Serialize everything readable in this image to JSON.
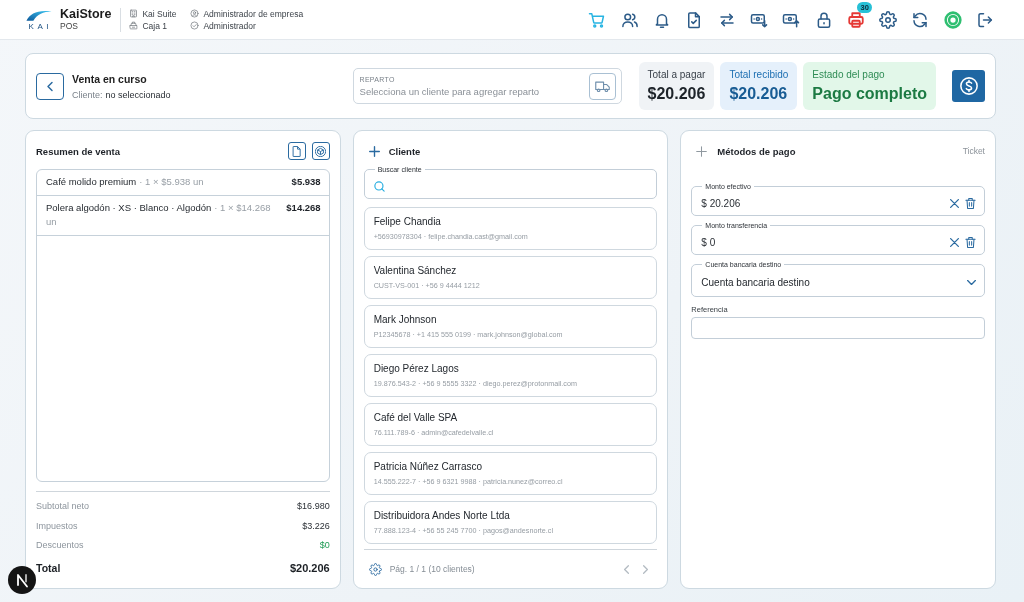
{
  "header": {
    "brand": {
      "logo_text": "KAI",
      "name": "KaiStore",
      "subtitle": "POS"
    },
    "context": [
      {
        "kind": "company",
        "label": "Kai Suite"
      },
      {
        "kind": "register",
        "label": "Caja 1"
      }
    ],
    "user": [
      {
        "kind": "role",
        "label": "Administrador de empresa"
      },
      {
        "kind": "profile",
        "label": "Administrador"
      }
    ],
    "toolbar": [
      {
        "kind": "cart",
        "selected": true
      },
      {
        "kind": "customers",
        "selected": false
      },
      {
        "kind": "notifications",
        "selected": false
      },
      {
        "kind": "documents",
        "selected": false
      },
      {
        "kind": "transfers",
        "selected": false
      },
      {
        "kind": "cash_in",
        "selected": false
      },
      {
        "kind": "cash_out",
        "selected": false
      },
      {
        "kind": "lock",
        "selected": false
      },
      {
        "kind": "printer",
        "selected": false,
        "color": "#e53935",
        "badge": "30"
      },
      {
        "kind": "settings",
        "selected": false
      },
      {
        "kind": "sync",
        "selected": false
      },
      {
        "kind": "status",
        "selected": false,
        "color": "#2fbf71"
      },
      {
        "kind": "logout",
        "selected": false
      }
    ]
  },
  "sale_bar": {
    "title": "Venta en curso",
    "client_label": "Cliente:",
    "client_value": "no seleccionado",
    "delivery": {
      "label": "REPARTO",
      "placeholder": "Selecciona un cliente para agregar reparto"
    },
    "totals": [
      {
        "kind": "due",
        "label": "Total a pagar",
        "value": "$20.206"
      },
      {
        "kind": "received",
        "label": "Total recibido",
        "value": "$20.206"
      },
      {
        "kind": "status",
        "label": "Estado del pago",
        "value": "Pago completo"
      }
    ]
  },
  "summary": {
    "title": "Resumen de venta",
    "items": [
      {
        "name": "Café molido premium",
        "detail": "· 1 × $5.938 un",
        "amount": "$5.938"
      },
      {
        "name": "Polera algodón · XS · Blanco · Algodón",
        "detail": "· 1 × $14.268 un",
        "amount": "$14.268"
      }
    ],
    "totals": [
      {
        "kind": "line",
        "label": "Subtotal neto",
        "value": "$16.980"
      },
      {
        "kind": "line",
        "label": "Impuestos",
        "value": "$3.226"
      },
      {
        "kind": "discount",
        "label": "Descuentos",
        "value": "$0"
      },
      {
        "kind": "total",
        "label": "Total",
        "value": "$20.206"
      }
    ]
  },
  "clients": {
    "title": "Cliente",
    "search": {
      "label": "Buscar cliente"
    },
    "list": [
      {
        "name": "Felipe Chandia",
        "detail": "+56930978304 · felipe.chandia.cast@gmail.com"
      },
      {
        "name": "Valentina Sánchez",
        "detail": "CUST-VS-001 · +56 9 4444 1212"
      },
      {
        "name": "Mark Johnson",
        "detail": "P12345678 · +1 415 555 0199 · mark.johnson@global.com"
      },
      {
        "name": "Diego Pérez Lagos",
        "detail": "19.876.543-2 · +56 9 5555 3322 · diego.perez@protonmail.com"
      },
      {
        "name": "Café del Valle SPA",
        "detail": "76.111.789-6 · admin@cafedelvalle.cl"
      },
      {
        "name": "Patricia Núñez Carrasco",
        "detail": "14.555.222-7 · +56 9 6321 9988 · patricia.nunez@correo.cl"
      },
      {
        "name": "Distribuidora Andes Norte Ltda",
        "detail": "77.888.123-4 · +56 55 245 7700 · pagos@andesnorte.cl"
      }
    ],
    "pager": {
      "text": "Pág. 1 / 1 (10 clientes)",
      "buttons": [
        {
          "kind": "prev",
          "disabled": true
        },
        {
          "kind": "next",
          "disabled": true
        }
      ]
    }
  },
  "payments": {
    "title": "Métodos de pago",
    "action": "Ticket",
    "fields": [
      {
        "kind": "amount",
        "label": "Monto efectivo",
        "value": "$ 20.206"
      },
      {
        "kind": "amount",
        "label": "Monto transferencia",
        "value": "$ 0"
      },
      {
        "kind": "select",
        "label": "Cuenta bancaria destino",
        "value": "Cuenta bancaria destino"
      },
      {
        "kind": "text",
        "label": "Referencia"
      }
    ]
  }
}
